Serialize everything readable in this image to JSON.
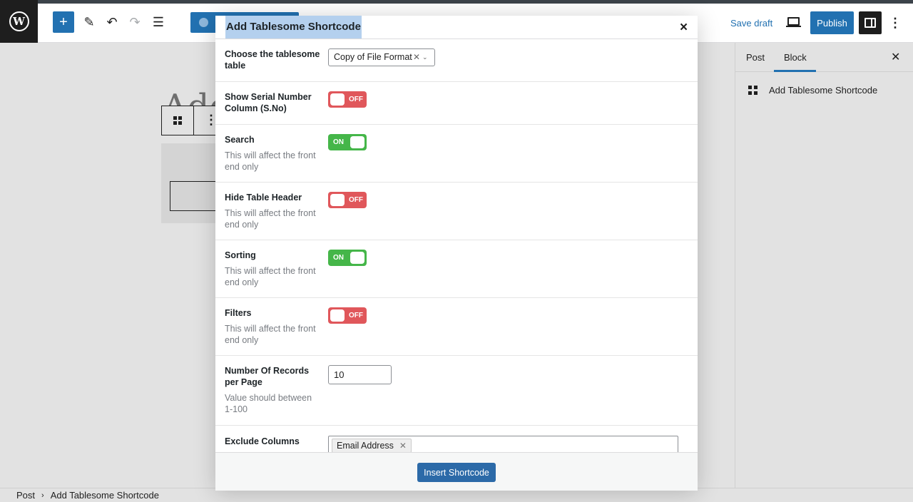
{
  "topbar": {
    "save_draft": "Save draft",
    "publish": "Publish"
  },
  "canvas": {
    "title_fragment": "Add"
  },
  "sidebar": {
    "tabs": [
      "Post",
      "Block"
    ],
    "active_tab": "Block",
    "block_name": "Add Tablesome Shortcode"
  },
  "breadcrumb": [
    "Post",
    "Add Tablesome Shortcode"
  ],
  "modal": {
    "title": "Add Tablesome Shortcode",
    "close": "×",
    "fields": {
      "table": {
        "label": "Choose the tablesome table",
        "value": "Copy of File Format"
      },
      "serial": {
        "label": "Show Serial Number Column (S.No)",
        "state": "OFF"
      },
      "search": {
        "label": "Search",
        "desc": "This will affect the front end only",
        "state": "ON"
      },
      "hide_header": {
        "label": "Hide Table Header",
        "desc": "This will affect the front end only",
        "state": "OFF"
      },
      "sorting": {
        "label": "Sorting",
        "desc": "This will affect the front end only",
        "state": "ON"
      },
      "filters": {
        "label": "Filters",
        "desc": "This will affect the front end only",
        "state": "OFF"
      },
      "records": {
        "label": "Number Of Records per Page",
        "desc": "Value should between 1-100",
        "value": "10"
      },
      "exclude": {
        "label": "Exclude Columns",
        "tags": [
          "Email Address"
        ]
      }
    },
    "insert_button": "Insert Shortcode"
  },
  "colors": {
    "accent": "#2271b1",
    "toggle_on": "#45b649",
    "toggle_off": "#e0575b",
    "selection": "#b4d0ee"
  }
}
